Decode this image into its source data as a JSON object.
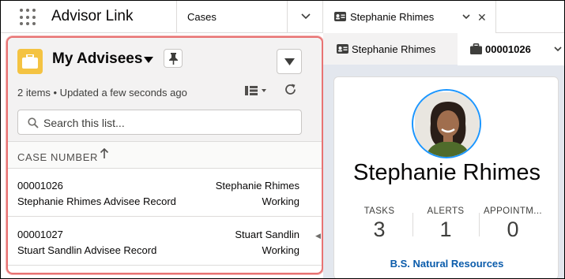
{
  "app": {
    "name": "Advisor Link"
  },
  "nav": {
    "items": [
      {
        "label": "Cases"
      }
    ]
  },
  "workspace_tab": {
    "label": "Stephanie Rhimes",
    "icon": "contact-card-icon"
  },
  "list_view": {
    "title": "My Advisees",
    "object_icon": "briefcase-icon",
    "meta": "2 items • Updated a few seconds ago",
    "search_placeholder": "Search this list...",
    "column_header": "CASE NUMBER",
    "rows": [
      {
        "case_number": "00001026",
        "subject": "Stephanie Rhimes Advisee Record",
        "contact": "Stephanie Rhimes",
        "status": "Working"
      },
      {
        "case_number": "00001027",
        "subject": "Stuart Sandlin Advisee Record",
        "contact": "Stuart Sandlin",
        "status": "Working"
      }
    ]
  },
  "subtabs": [
    {
      "label": "Stephanie Rhimes",
      "icon": "contact-card-icon"
    },
    {
      "label": "00001026",
      "icon": "briefcase-icon"
    }
  ],
  "profile": {
    "name": "Stephanie Rhimes",
    "stats": [
      {
        "label": "TASKS",
        "value": "3"
      },
      {
        "label": "ALERTS",
        "value": "1"
      },
      {
        "label": "APPOINTM...",
        "value": "0"
      }
    ],
    "major": "B.S. Natural Resources"
  },
  "colors": {
    "accent_blue": "#0b5cab",
    "highlight_border": "#e87373",
    "object_icon_bg": "#f4c342",
    "right_panel_bg": "#e3e7ee"
  }
}
